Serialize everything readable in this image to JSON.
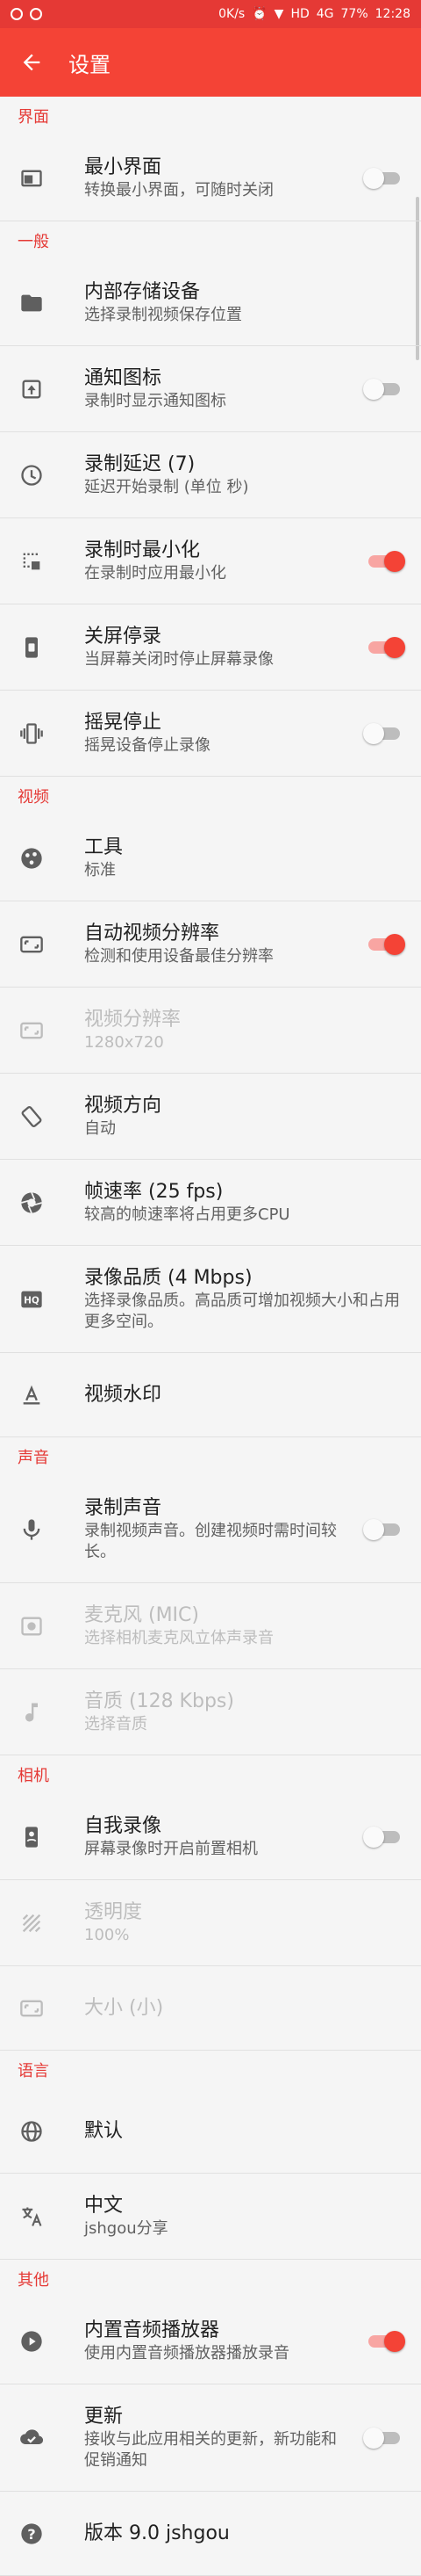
{
  "status": {
    "net": "0K/s",
    "hd": "HD",
    "four_g": "4G",
    "battery": "77%",
    "time": "12:28"
  },
  "appbar": {
    "title": "设置"
  },
  "groups": [
    {
      "title": "界面",
      "items": [
        {
          "icon": "window-icon",
          "title": "最小界面",
          "subtitle": "转换最小界面，可随时关闭",
          "toggle": "off"
        }
      ]
    },
    {
      "title": "一般",
      "items": [
        {
          "icon": "folder-icon",
          "title": "内部存储设备",
          "subtitle": "选择录制视频保存位置"
        },
        {
          "icon": "notification-icon",
          "title": "通知图标",
          "subtitle": "录制时显示通知图标",
          "toggle": "off"
        },
        {
          "icon": "clock-icon",
          "title": "录制延迟 (7)",
          "subtitle": "延迟开始录制 (单位 秒)"
        },
        {
          "icon": "minimize-icon",
          "title": "录制时最小化",
          "subtitle": "在录制时应用最小化",
          "toggle": "on"
        },
        {
          "icon": "phone-icon",
          "title": "关屏停录",
          "subtitle": "当屏幕关闭时停止屏幕录像",
          "toggle": "on"
        },
        {
          "icon": "vibrate-icon",
          "title": "摇晃停止",
          "subtitle": "摇晃设备停止录像",
          "toggle": "off"
        }
      ]
    },
    {
      "title": "视频",
      "items": [
        {
          "icon": "palette-icon",
          "title": "工具",
          "subtitle": "标准"
        },
        {
          "icon": "aspect-ratio-icon",
          "title": "自动视频分辨率",
          "subtitle": "检测和使用设备最佳分辨率",
          "toggle": "on"
        },
        {
          "icon": "aspect-ratio-icon",
          "title": "视频分辨率",
          "subtitle": "1280x720",
          "disabled": true
        },
        {
          "icon": "rotate-icon",
          "title": "视频方向",
          "subtitle": "自动"
        },
        {
          "icon": "shutter-icon",
          "title": "帧速率 (25 fps)",
          "subtitle": "较高的帧速率将占用更多CPU"
        },
        {
          "icon": "hq-icon",
          "title": "录像品质 (4 Mbps)",
          "subtitle": "选择录像品质。高品质可增加视频大小和占用更多空间。",
          "tall": true
        },
        {
          "icon": "text-icon",
          "title": "视频水印",
          "subtitle": ""
        }
      ]
    },
    {
      "title": "声音",
      "items": [
        {
          "icon": "mic-icon",
          "title": "录制声音",
          "subtitle": "录制视频声音。创建视频时需时间较长。",
          "toggle": "off",
          "tall": true
        },
        {
          "icon": "speaker-icon",
          "title": "麦克风 (MIC)",
          "subtitle": "选择相机麦克风立体声录音",
          "disabled": true
        },
        {
          "icon": "music-icon",
          "title": "音质 (128 Kbps)",
          "subtitle": "选择音质",
          "disabled": true
        }
      ]
    },
    {
      "title": "相机",
      "items": [
        {
          "icon": "selfie-icon",
          "title": "自我录像",
          "subtitle": "屏幕录像时开启前置相机",
          "toggle": "off"
        },
        {
          "icon": "opacity-icon",
          "title": "透明度",
          "subtitle": "100%",
          "disabled": true
        },
        {
          "icon": "aspect-ratio-icon",
          "title": "大小 (小)",
          "subtitle": "",
          "disabled": true
        }
      ]
    },
    {
      "title": "语言",
      "items": [
        {
          "icon": "globe-icon",
          "title": "默认",
          "subtitle": ""
        },
        {
          "icon": "translate-icon",
          "title": "中文",
          "subtitle": "jshgou分享"
        }
      ]
    },
    {
      "title": "其他",
      "items": [
        {
          "icon": "play-icon",
          "title": "内置音频播放器",
          "subtitle": "使用内置音频播放器播放录音",
          "toggle": "on"
        },
        {
          "icon": "cloud-check-icon",
          "title": "更新",
          "subtitle": "接收与此应用相关的更新，新功能和促销通知",
          "toggle": "off",
          "tall": true
        },
        {
          "icon": "help-icon",
          "title": "版本 9.0 jshgou",
          "subtitle": ""
        }
      ]
    }
  ]
}
